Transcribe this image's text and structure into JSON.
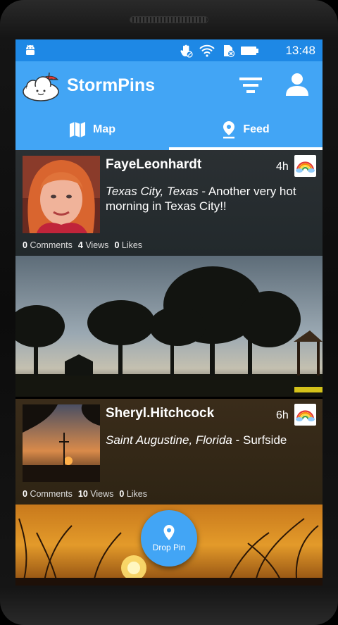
{
  "status_bar": {
    "time": "13:48",
    "icons": [
      "android-icon",
      "touch-off-icon",
      "wifi-icon",
      "no-sim-icon",
      "battery-icon"
    ]
  },
  "app": {
    "title": "StormPins",
    "brand_color": "#42a5f5",
    "status_color": "#1e88e5"
  },
  "tabs": [
    {
      "label": "Map",
      "icon": "map-icon",
      "active": false
    },
    {
      "label": "Feed",
      "icon": "location-pin-icon",
      "active": true
    }
  ],
  "posts": [
    {
      "user": "FayeLeonhardt",
      "ago": "4h",
      "location": "Texas City, Texas",
      "separator": " - ",
      "text": "Another very hot morning in Texas City!!",
      "comments": "0",
      "comments_label": "Comments",
      "views": "4",
      "views_label": "Views",
      "likes": "0",
      "likes_label": "Likes",
      "badge_icon": "rainbow-icon"
    },
    {
      "user": "Sheryl.Hitchcock",
      "ago": "6h",
      "location": "Saint Augustine, Florida",
      "separator": " - ",
      "text": "Surfside",
      "comments": "0",
      "comments_label": "Comments",
      "views": "10",
      "views_label": "Views",
      "likes": "0",
      "likes_label": "Likes",
      "badge_icon": "rainbow-icon"
    }
  ],
  "fab": {
    "label": "Drop Pin",
    "icon": "location-pin-icon"
  }
}
